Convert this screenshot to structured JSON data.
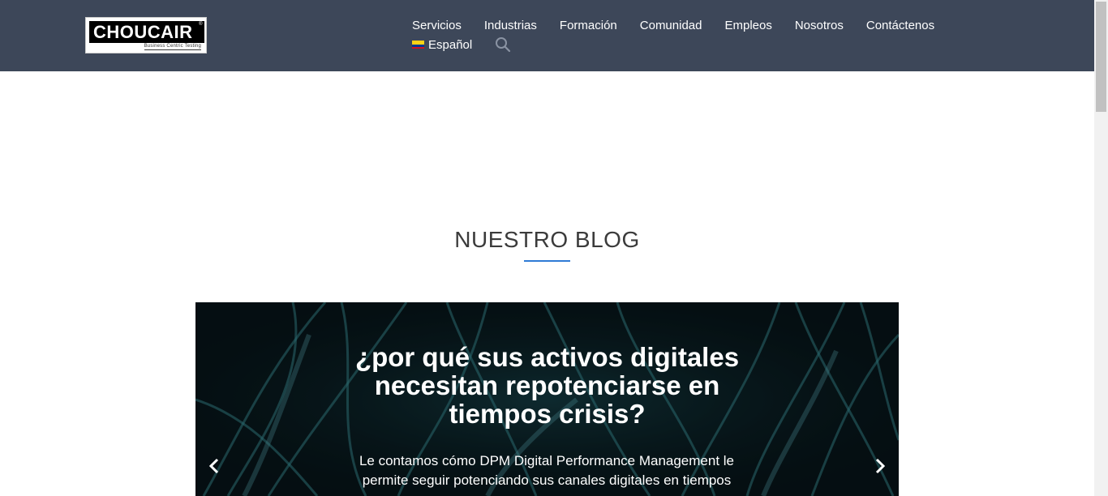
{
  "header": {
    "logo": {
      "brand": "CHOUCAIR",
      "registered": "®",
      "tagline": "Business Centric Testing"
    },
    "nav": [
      "Servicios",
      "Industrias",
      "Formación",
      "Comunidad",
      "Empleos",
      "Nosotros",
      "Contáctenos"
    ],
    "language": "Español",
    "search_icon": "search-icon",
    "flag_colors": [
      "#fcd116",
      "#003893",
      "#ce1126"
    ]
  },
  "blog": {
    "title": "NUESTRO BLOG",
    "accent_color": "#2f7bd5"
  },
  "slider": {
    "heading": "¿por qué sus activos digitales necesitan repotenciarse en tiempos crisis?",
    "text": "Le contamos cómo DPM Digital Performance Management le permite seguir potenciando sus canales digitales en tiempos",
    "prev_icon": "chevron-left-icon",
    "next_icon": "chevron-right-icon"
  }
}
